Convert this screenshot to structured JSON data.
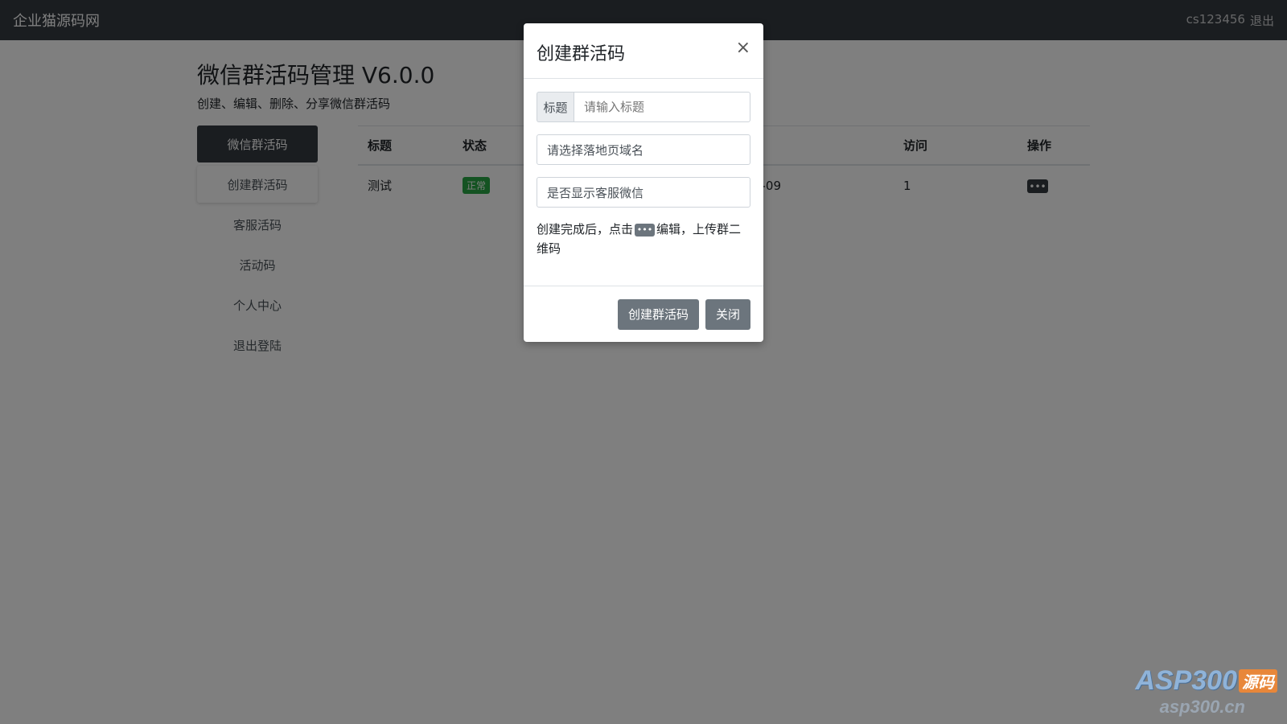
{
  "navbar": {
    "brand": "企业猫源码网",
    "user": "cs123456",
    "logout": "退出"
  },
  "header": {
    "title": "微信群活码管理 V6.0.0",
    "subtitle": "创建、编辑、删除、分享微信群活码"
  },
  "sidebar": {
    "items": [
      {
        "label": "微信群活码"
      },
      {
        "label": "创建群活码"
      },
      {
        "label": "客服活码"
      },
      {
        "label": "活动码"
      },
      {
        "label": "个人中心"
      },
      {
        "label": "退出登陆"
      }
    ]
  },
  "table": {
    "columns": [
      "标题",
      "状态",
      "",
      "访问",
      "操作"
    ],
    "rows": [
      {
        "title": "测试",
        "status": "正常",
        "date_fragment": "-09",
        "visits": "1",
        "action_icon": "more-icon"
      }
    ]
  },
  "modal": {
    "title": "创建群活码",
    "close_symbol": "×",
    "title_label": "标题",
    "title_placeholder": "请输入标题",
    "domain_select": "请选择落地页域名",
    "show_service_select": "是否显示客服微信",
    "hint_before": "创建完成后，点击",
    "hint_after": "编辑，上传群二维码",
    "create_button": "创建群活码",
    "close_button": "关闭"
  },
  "watermark": {
    "logo_text": "ASP300",
    "logo_tag": "源码",
    "url": "asp300.cn"
  },
  "colors": {
    "navbar": "#343a40",
    "badge_success": "#28a745",
    "button_secondary": "#6c757d",
    "backdrop": "rgba(0,0,0,0.5)"
  }
}
